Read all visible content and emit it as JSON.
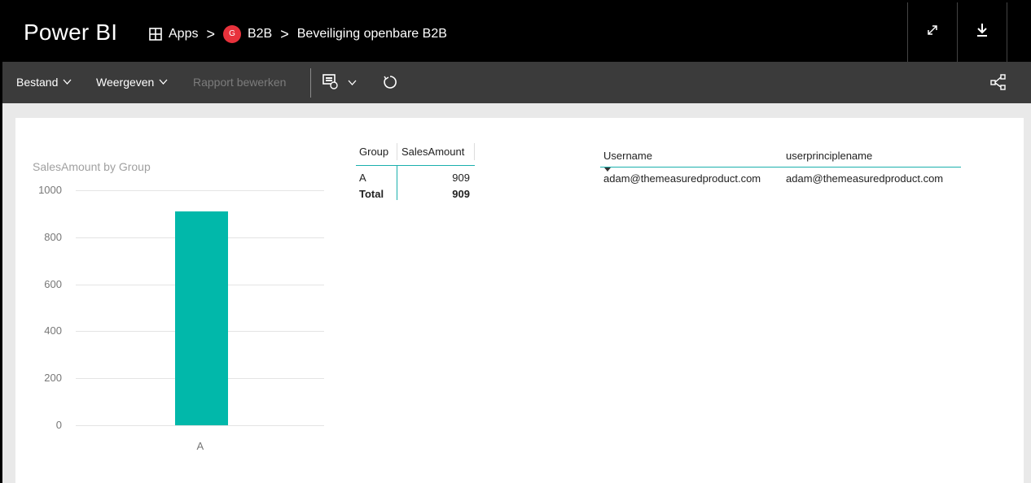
{
  "header": {
    "brand": "Power BI",
    "breadcrumb": {
      "apps_label": "Apps",
      "separator": ">",
      "workspace_initial": "G",
      "workspace_label": "B2B",
      "report_label": "Beveiliging openbare B2B"
    },
    "icons": [
      "expand-icon",
      "download-icon"
    ]
  },
  "toolbar": {
    "file_label": "Bestand",
    "view_label": "Weergeven",
    "edit_label": "Rapport bewerken",
    "icons": [
      "chevron-down-icon",
      "visual-icon",
      "refresh-icon",
      "share-icon"
    ]
  },
  "colors": {
    "bar": "#01b8aa",
    "accent_line": "#1bb0ad",
    "workspace_badge": "#e8323c"
  },
  "chart_data": {
    "type": "bar",
    "title": "SalesAmount by Group",
    "categories": [
      "A"
    ],
    "values": [
      909
    ],
    "ylim": [
      0,
      1000
    ],
    "yticks": [
      "1000",
      "800",
      "600",
      "400",
      "200",
      "0"
    ],
    "grid": true
  },
  "group_table": {
    "columns": [
      "Group",
      "SalesAmount"
    ],
    "rows": [
      {
        "group": "A",
        "amount": "909"
      }
    ],
    "total": {
      "label": "Total",
      "amount": "909"
    }
  },
  "user_table": {
    "columns": [
      "Username",
      "userprinciplename"
    ],
    "rows": [
      {
        "username": "adam@themeasuredproduct.com",
        "upn": "adam@themeasuredproduct.com"
      }
    ]
  }
}
